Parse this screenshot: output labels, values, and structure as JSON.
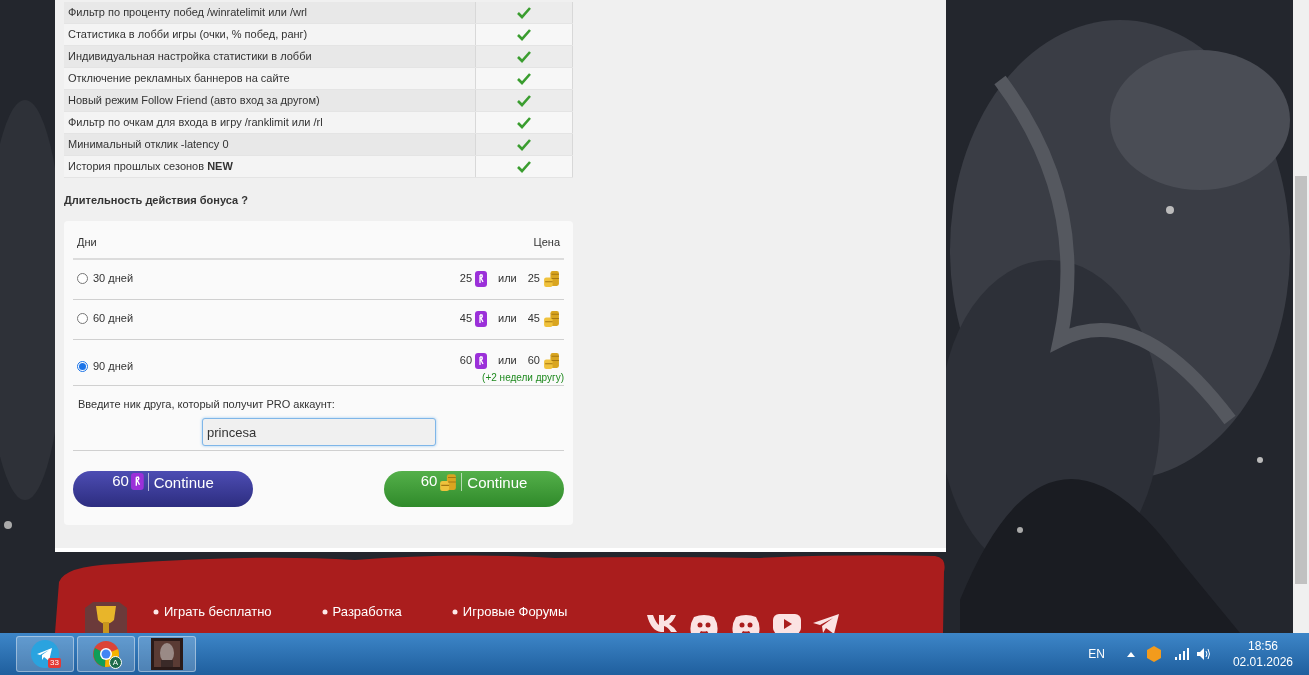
{
  "features": [
    {
      "label": "Фильтр по проценту побед /winratelimit или /wrl",
      "available": true
    },
    {
      "label": "Статистика в лобби игры (очки, % побед, ранг)",
      "available": true
    },
    {
      "label": "Индивидуальная настройка статистики в лобби",
      "available": true
    },
    {
      "label": "Отключение рекламных баннеров на сайте",
      "available": true
    },
    {
      "label": "Новый режим Follow Friend (авто вход за другом)",
      "available": true
    },
    {
      "label": "Фильтр по очкам для входа в игру /ranklimit или /rl",
      "available": true
    },
    {
      "label": "Минимальный отклик -latency 0",
      "available": true
    },
    {
      "label": "История прошлых сезонов **NEW**",
      "available": true
    }
  ],
  "duration_title": "Длительность действия бонуса ?",
  "price_table": {
    "columns": [
      "Дни",
      "Цена"
    ],
    "rows": [
      {
        "label": "30 дней",
        "selected": false,
        "rubies": "25",
        "or": "или",
        "gold": "25"
      },
      {
        "label": "60 дней",
        "selected": false,
        "rubies": "45",
        "or": "или",
        "gold": "45"
      },
      {
        "label": "90 дней",
        "selected": true,
        "rubies": "60",
        "or": "или",
        "gold": "60",
        "note": "(+2 недели другу)"
      }
    ]
  },
  "friend": {
    "label": "Введите ник друга, который получит PRO аккаунт:",
    "value": "princesa"
  },
  "buttons": [
    {
      "kind": "rubies",
      "amount": "60",
      "label": "Continue"
    },
    {
      "kind": "gold",
      "amount": "60",
      "label": "Continue"
    }
  ],
  "footer_links": [
    [
      "Играть бесплатно"
    ],
    [
      "Разработка"
    ],
    [
      "Игровые Форумы"
    ]
  ],
  "taskbar": {
    "apps": [
      {
        "kind": "telegram",
        "badge": "33"
      },
      {
        "kind": "chrome",
        "badge": "A"
      },
      {
        "kind": "game"
      }
    ],
    "language": "EN",
    "time": "18:56",
    "date": "02.01.2026"
  }
}
